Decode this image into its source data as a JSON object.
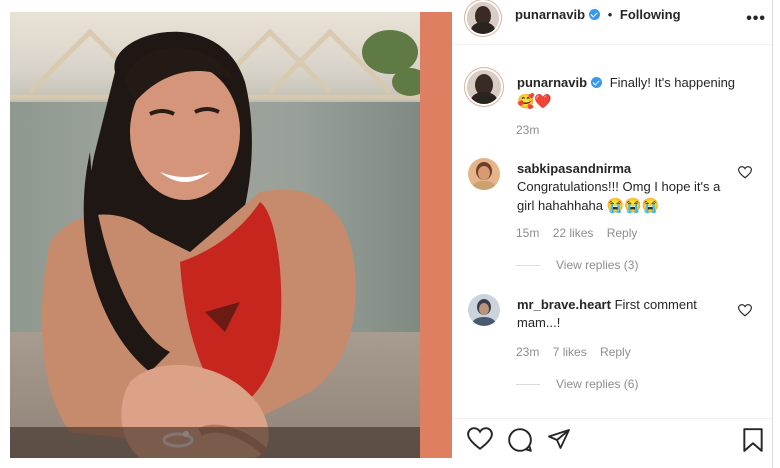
{
  "post": {
    "author": "punarnavib",
    "follow_status": "Following",
    "separator": "•",
    "more_label": "•••",
    "caption": "Finally! It's happening",
    "caption_emoji": "🥰❤️",
    "caption_time": "23m"
  },
  "comments": [
    {
      "username": "sabkipasandnirma",
      "text": "Congratulations!!! Omg I hope it's a girl hahahhaha",
      "emoji": "😭😭😭",
      "time": "15m",
      "likes": "22 likes",
      "reply_label": "Reply",
      "view_replies": "View replies (3)"
    },
    {
      "username": "mr_brave.heart",
      "text": "First comment mam...!",
      "time": "23m",
      "likes": "7 likes",
      "reply_label": "Reply",
      "view_replies": "View replies (6)"
    }
  ],
  "icons": {
    "like": "heart-icon",
    "comment": "comment-icon",
    "share": "share-icon",
    "save": "bookmark-icon",
    "comment_like": "heart-icon",
    "verified": "verified-badge-icon"
  },
  "colors": {
    "accent_strip": "#de7f62",
    "verified": "#3897f0",
    "text": "#262626",
    "muted": "#8e8e8e"
  }
}
